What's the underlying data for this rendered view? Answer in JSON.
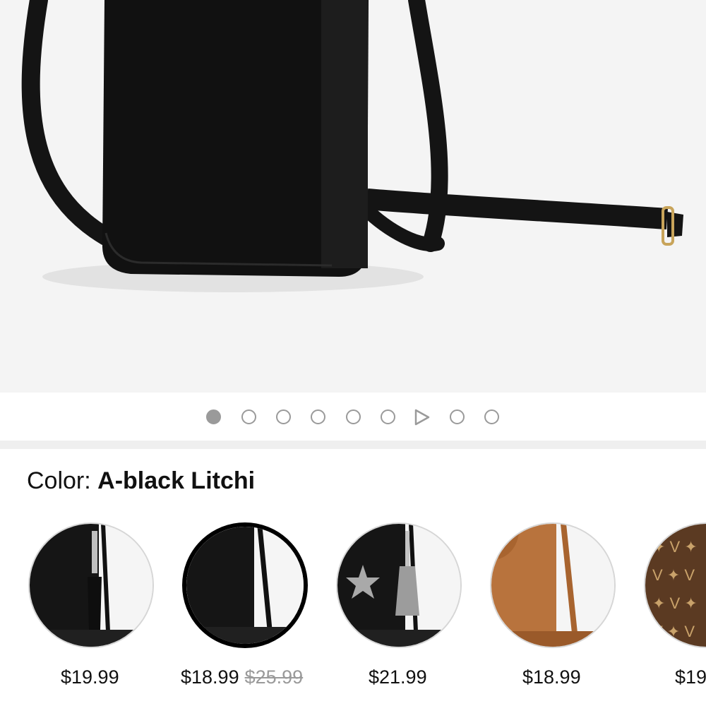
{
  "carousel": {
    "slide_count": 9,
    "active_index": 0,
    "video_index": 6
  },
  "color_selector": {
    "label": "Color:",
    "selected_name": "A-black Litchi"
  },
  "variants": [
    {
      "price": "$19.99",
      "original_price": "",
      "selected": false,
      "color": "#1a1a1a"
    },
    {
      "price": "$18.99",
      "original_price": "$25.99",
      "selected": true,
      "color": "#1a1a1a"
    },
    {
      "price": "$21.99",
      "original_price": "",
      "selected": false,
      "color": "#1a1a1a"
    },
    {
      "price": "$18.99",
      "original_price": "",
      "selected": false,
      "color": "#b8733d"
    },
    {
      "price": "$19",
      "original_price": "",
      "selected": false,
      "color": "#5b3a22"
    }
  ],
  "colors": {
    "page_bg": "#ffffff",
    "hero_bg": "#f4f4f4",
    "dot_gray": "#9a9a9a",
    "divider": "#efefef",
    "strike_gray": "#9a9a9a"
  }
}
